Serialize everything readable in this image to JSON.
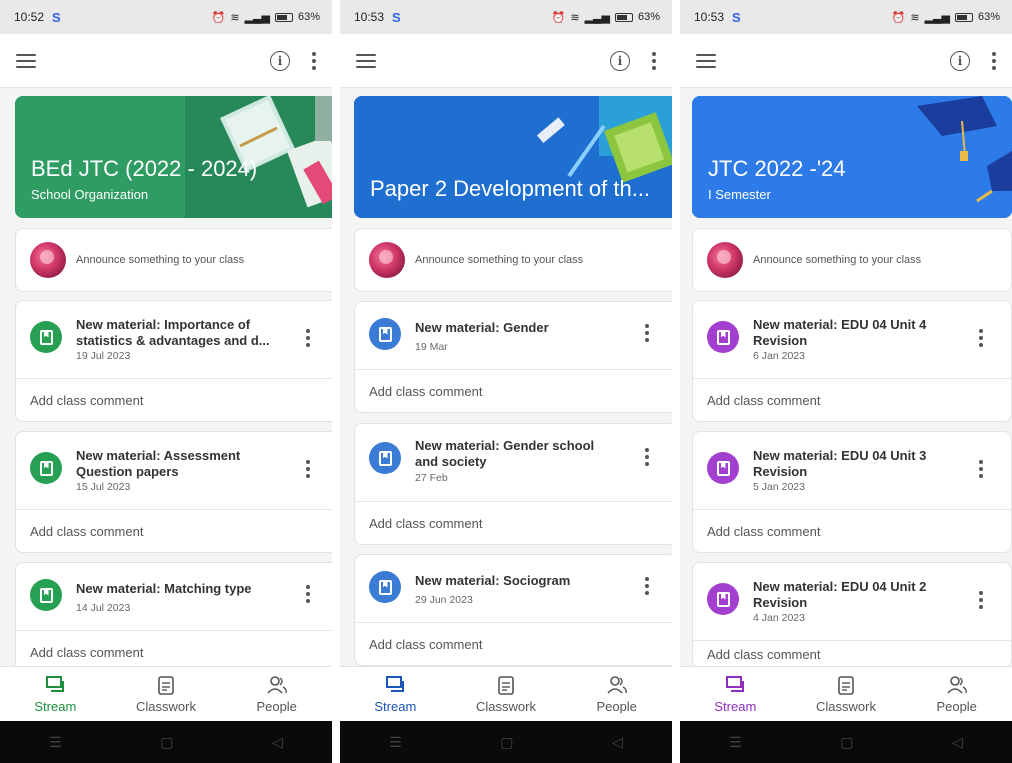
{
  "colors": {
    "green": "#27a053",
    "blue_icon": "#3a7bd5",
    "purple_icon": "#a23fcf",
    "banner1": "#2e9c63",
    "banner2": "#1f6fd1",
    "banner3": "#2c7be8"
  },
  "phones": [
    {
      "status": {
        "time": "10:52",
        "battery": "63%"
      },
      "banner": {
        "title": "BEd JTC (2022 - 2024)",
        "subtitle": "School Organization"
      },
      "announce": "Announce something to your class",
      "accent": "#27a053",
      "posts": [
        {
          "title": "New material: Importance of statistics & advantages and d...",
          "date": "19 Jul 2023",
          "comment": "Add class comment"
        },
        {
          "title": "New material: Assessment Question papers",
          "date": "15 Jul 2023",
          "comment": "Add class comment"
        },
        {
          "title": "New material: Matching type",
          "date": "14 Jul 2023",
          "comment": "Add class comment"
        }
      ],
      "nav": {
        "stream": "Stream",
        "classwork": "Classwork",
        "people": "People"
      }
    },
    {
      "status": {
        "time": "10:53",
        "battery": "63%"
      },
      "banner": {
        "title": "Paper 2 Development of th...",
        "subtitle": ""
      },
      "announce": "Announce something to your class",
      "accent": "#1f6fd1",
      "posts": [
        {
          "title": "New material: Gender",
          "date": "19 Mar",
          "comment": "Add class comment"
        },
        {
          "title": "New material: Gender school and society",
          "date": "27 Feb",
          "comment": "Add class comment"
        },
        {
          "title": "New material: Sociogram",
          "date": "29 Jun 2023",
          "comment": "Add class comment"
        }
      ],
      "nav": {
        "stream": "Stream",
        "classwork": "Classwork",
        "people": "People"
      }
    },
    {
      "status": {
        "time": "10:53",
        "battery": "63%"
      },
      "banner": {
        "title": "JTC 2022 -'24",
        "subtitle": "I Semester"
      },
      "announce": "Announce something to your class",
      "accent": "#a23fcf",
      "posts": [
        {
          "title": "New material: EDU 04 Unit 4 Revision",
          "date": "6 Jan 2023",
          "comment": "Add class comment"
        },
        {
          "title": "New material: EDU 04 Unit 3 Revision",
          "date": "5 Jan 2023",
          "comment": "Add class comment"
        },
        {
          "title": "New material: EDU 04 Unit 2 Revision",
          "date": "4 Jan 2023",
          "comment": "Add class comment"
        }
      ],
      "nav": {
        "stream": "Stream",
        "classwork": "Classwork",
        "people": "People"
      }
    }
  ]
}
